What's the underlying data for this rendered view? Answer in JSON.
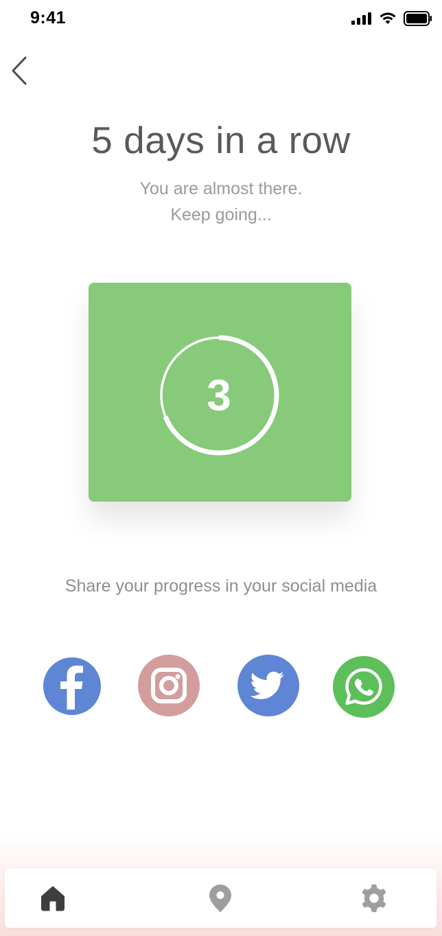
{
  "status_bar": {
    "time": "9:41"
  },
  "header": {
    "title": "5 days in a row"
  },
  "subtitle": {
    "line1": "You are almost there.",
    "line2": "Keep going..."
  },
  "progress_card": {
    "count": "3",
    "ring_progress": 0.69,
    "color": "#86ca7a"
  },
  "share": {
    "text": "Share your progress in your social media",
    "networks": [
      {
        "name": "facebook-icon",
        "color": "#5f86d4"
      },
      {
        "name": "instagram-icon",
        "color": "#d39d9d"
      },
      {
        "name": "twitter-icon",
        "color": "#5f86d4"
      },
      {
        "name": "whatsapp-icon",
        "color": "#5cbf5a"
      }
    ]
  },
  "bottom_nav": {
    "items": [
      "home-icon",
      "location-pin-icon",
      "gear-icon"
    ],
    "active": "home-icon"
  }
}
